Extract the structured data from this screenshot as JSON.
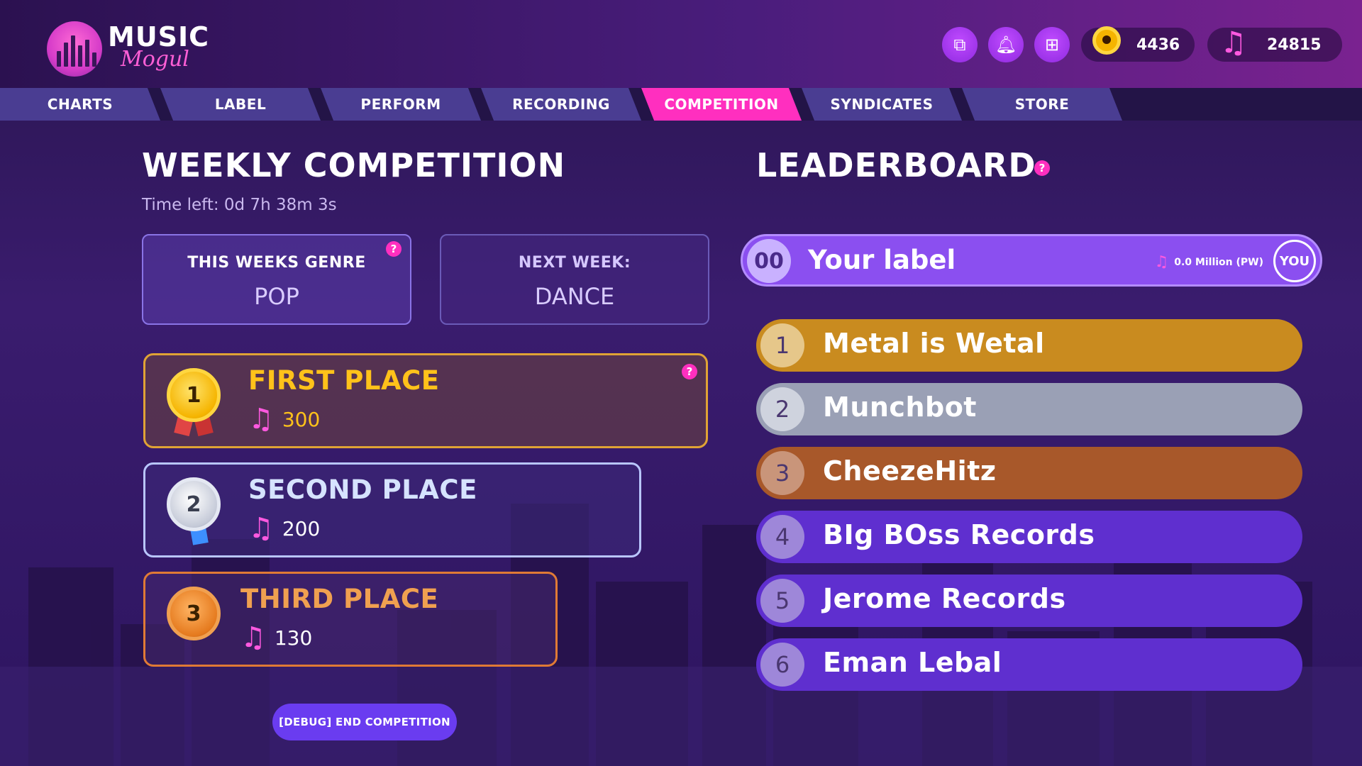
{
  "app": {
    "logo_title": "MUSIC",
    "logo_subtitle": "Mogul"
  },
  "header": {
    "buttons": [
      {
        "icon": "copy-icon"
      },
      {
        "icon": "bell-icon"
      },
      {
        "icon": "plus-square-icon"
      }
    ],
    "coins": "4436",
    "notes": "24815"
  },
  "tabs": [
    {
      "label": "CHARTS",
      "active": false
    },
    {
      "label": "LABEL",
      "active": false
    },
    {
      "label": "PERFORM",
      "active": false
    },
    {
      "label": "RECORDING",
      "active": false
    },
    {
      "label": "COMPETITION",
      "active": true
    },
    {
      "label": "SYNDICATES",
      "active": false
    },
    {
      "label": "STORE",
      "active": false
    }
  ],
  "competition": {
    "title": "WEEKLY COMPETITION",
    "time_left": "Time left: 0d 7h 38m 3s",
    "this_week_label": "THIS WEEKS GENRE",
    "this_week_value": "POP",
    "next_week_label": "NEXT WEEK:",
    "next_week_value": "DANCE",
    "help": "?",
    "prizes": [
      {
        "title": "FIRST PLACE",
        "value": "300",
        "medal": "1"
      },
      {
        "title": "SECOND PLACE",
        "value": "200",
        "medal": "2"
      },
      {
        "title": "THIRD PLACE",
        "value": "130",
        "medal": "3"
      }
    ],
    "debug_button": "[DEBUG] END COMPETITION"
  },
  "leaderboard": {
    "title": "LEADERBOARD",
    "help": "?",
    "you": {
      "rank": "00",
      "name": "Your label",
      "stat": "0.0 Million (PW)",
      "badge": "YOU"
    },
    "rows": [
      {
        "rank": "1",
        "name": "Metal is Wetal"
      },
      {
        "rank": "2",
        "name": "Munchbot"
      },
      {
        "rank": "3",
        "name": "CheezeHitz"
      },
      {
        "rank": "4",
        "name": "BIg BOss Records"
      },
      {
        "rank": "5",
        "name": "Jerome Records"
      },
      {
        "rank": "6",
        "name": "Eman Lebal"
      }
    ]
  },
  "colors": {
    "accent_pink": "#ff2fbf",
    "gold": "#c98b1f",
    "silver": "#9aa0b5",
    "bronze": "#a8582a",
    "purple_row": "#5f2fcf"
  }
}
